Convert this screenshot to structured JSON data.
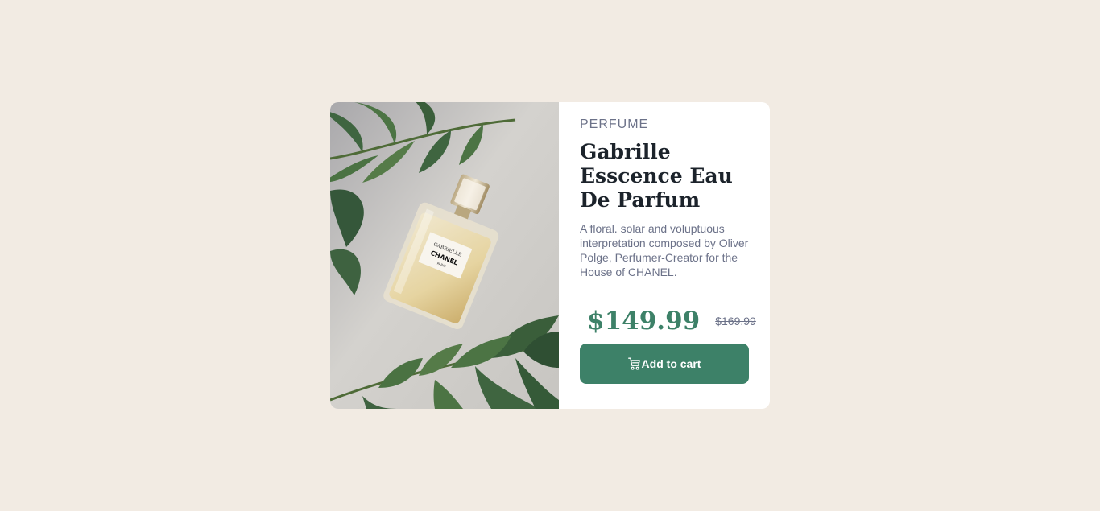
{
  "product": {
    "category": "PERFUME",
    "title": "Gabrille Esscence Eau De Parfum",
    "description": "A floral. solar and voluptuous interpretation composed by Oliver Polge, Perfumer-Creator for the House of CHANEL.",
    "price_current": "$149.99",
    "price_old": "$169.99",
    "cart_button_label": "Add to cart",
    "cart_icon": "cart-icon",
    "image_label": "GABRIELLE CHANEL PARIS"
  },
  "colors": {
    "background": "#F2EBE3",
    "card": "#FFFFFF",
    "accent": "#3D8168",
    "muted_text": "#6C7289",
    "heading_text": "#1C232B"
  }
}
